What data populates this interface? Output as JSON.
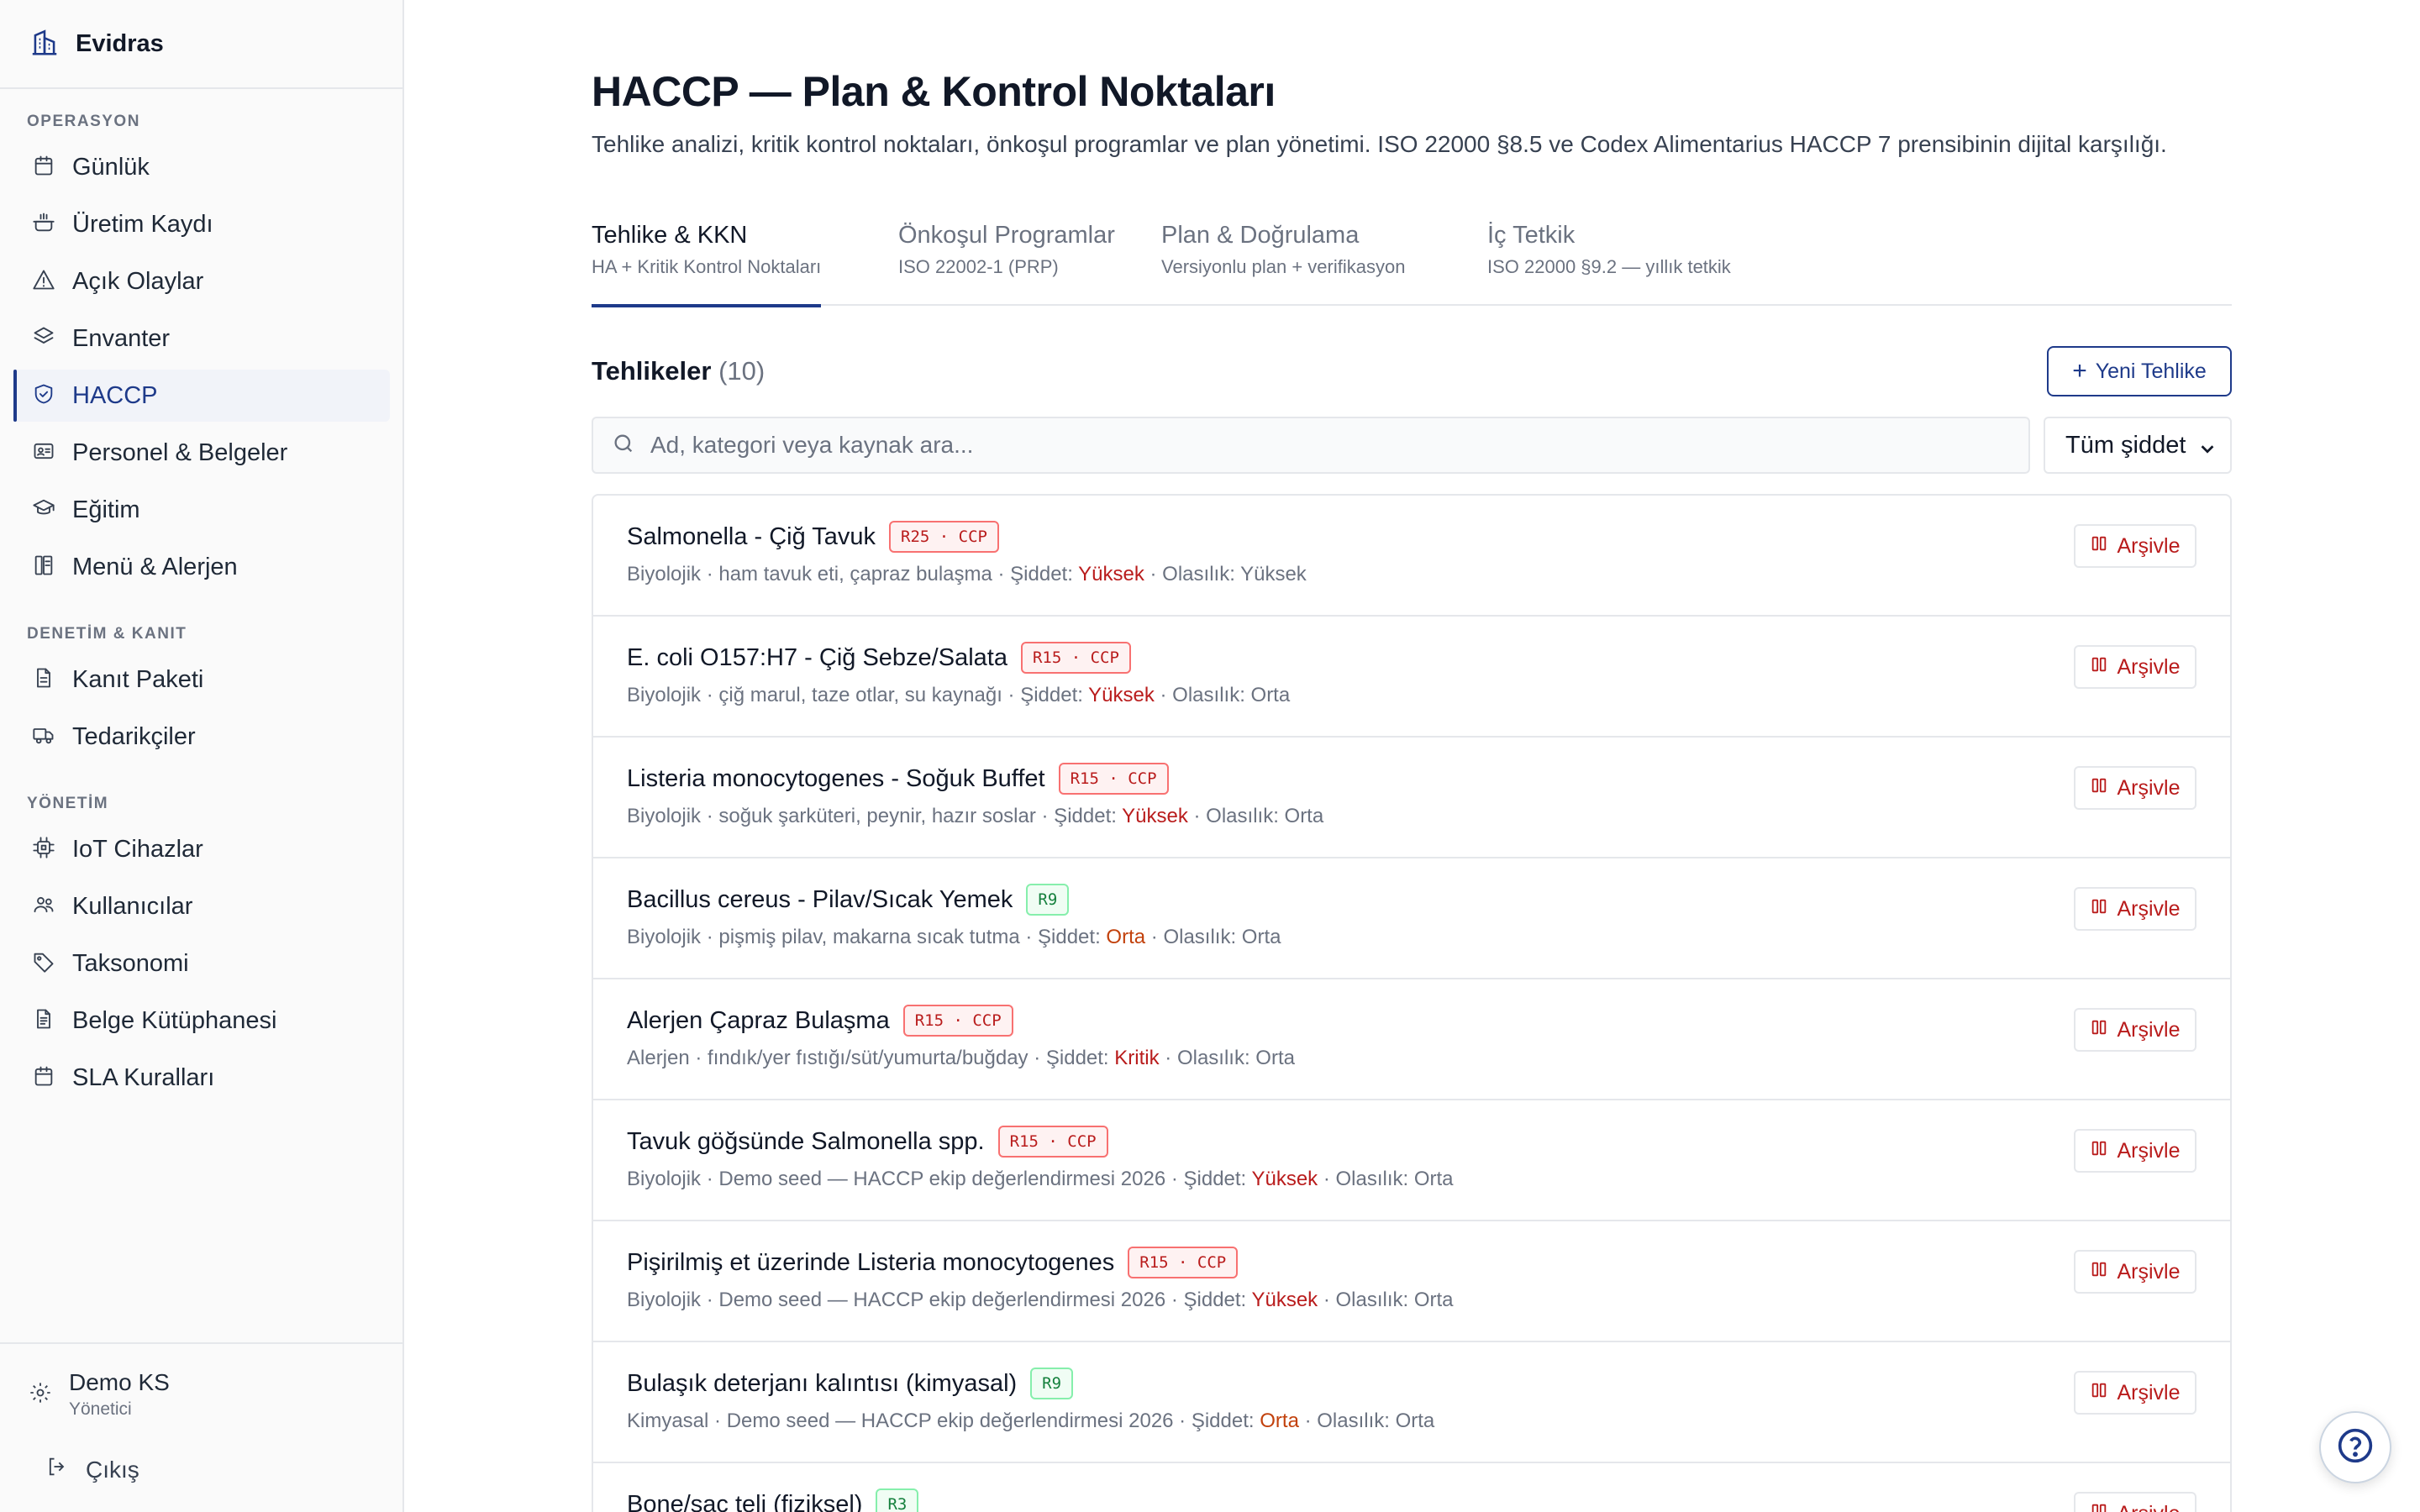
{
  "brand": {
    "name": "Evidras"
  },
  "sidebar": {
    "sections": [
      {
        "label": "OPERASYON",
        "items": [
          {
            "label": "Günlük",
            "icon": "calendar-icon"
          },
          {
            "label": "Üretim Kaydı",
            "icon": "cooking-pot-icon"
          },
          {
            "label": "Açık Olaylar",
            "icon": "warning-triangle-icon"
          },
          {
            "label": "Envanter",
            "icon": "layers-icon"
          },
          {
            "label": "HACCP",
            "icon": "shield-check-icon",
            "active": true
          },
          {
            "label": "Personel & Belgeler",
            "icon": "id-card-icon"
          },
          {
            "label": "Eğitim",
            "icon": "graduation-cap-icon"
          },
          {
            "label": "Menü & Alerjen",
            "icon": "menu-book-icon"
          }
        ]
      },
      {
        "label": "DENETİM & KANIT",
        "items": [
          {
            "label": "Kanıt Paketi",
            "icon": "document-icon"
          },
          {
            "label": "Tedarikçiler",
            "icon": "truck-icon"
          }
        ]
      },
      {
        "label": "YÖNETİM",
        "items": [
          {
            "label": "IoT Cihazlar",
            "icon": "chip-icon"
          },
          {
            "label": "Kullanıcılar",
            "icon": "users-icon"
          },
          {
            "label": "Taksonomi",
            "icon": "tag-icon"
          },
          {
            "label": "Belge Kütüphanesi",
            "icon": "file-text-icon"
          },
          {
            "label": "SLA Kuralları",
            "icon": "calendar-icon"
          }
        ]
      }
    ],
    "user": {
      "name": "Demo KS",
      "role": "Yönetici"
    },
    "logout_label": "Çıkış"
  },
  "page": {
    "title": "HACCP — Plan & Kontrol Noktaları",
    "description": "Tehlike analizi, kritik kontrol noktaları, önkoşul programlar ve plan yönetimi. ISO 22000 §8.5 ve Codex Alimentarius HACCP 7 prensibinin dijital karşılığı."
  },
  "tabs": [
    {
      "title": "Tehlike & KKN",
      "subtitle": "HA + Kritik Kontrol Noktaları",
      "active": true
    },
    {
      "title": "Önkoşul Programlar",
      "subtitle": "ISO 22002-1 (PRP)"
    },
    {
      "title": "Plan & Doğrulama",
      "subtitle": "Versiyonlu plan + verifikasyon"
    },
    {
      "title": "İç Tetkik",
      "subtitle": "ISO 22000 §9.2 — yıllık tetkik"
    }
  ],
  "hazards_header": {
    "title": "Tehlikeler",
    "count": "(10)",
    "new_button": "Yeni Tehlike"
  },
  "search": {
    "placeholder": "Ad, kategori veya kaynak ara...",
    "value": ""
  },
  "severity_filter": {
    "selected": "Tüm şiddet"
  },
  "labels": {
    "severity": "Şiddet:",
    "likelihood": "Olasılık:",
    "archive": "Arşivle",
    "sep": " · "
  },
  "colors": {
    "accent": "#1e3a8a",
    "danger": "#b91c1c",
    "warning": "#c2410c",
    "success": "#15803d"
  },
  "hazards": [
    {
      "name": "Salmonella - Çiğ Tavuk",
      "badge": "R25 · CCP",
      "badge_type": "red",
      "category": "Biyolojik",
      "source": "ham tavuk eti, çapraz bulaşma",
      "severity": "Yüksek",
      "severity_level": "hi",
      "likelihood": "Yüksek"
    },
    {
      "name": "E. coli O157:H7 - Çiğ Sebze/Salata",
      "badge": "R15 · CCP",
      "badge_type": "red",
      "category": "Biyolojik",
      "source": "çiğ marul, taze otlar, su kaynağı",
      "severity": "Yüksek",
      "severity_level": "hi",
      "likelihood": "Orta"
    },
    {
      "name": "Listeria monocytogenes - Soğuk Buffet",
      "badge": "R15 · CCP",
      "badge_type": "red",
      "category": "Biyolojik",
      "source": "soğuk şarküteri, peynir, hazır soslar",
      "severity": "Yüksek",
      "severity_level": "hi",
      "likelihood": "Orta"
    },
    {
      "name": "Bacillus cereus - Pilav/Sıcak Yemek",
      "badge": "R9",
      "badge_type": "green",
      "category": "Biyolojik",
      "source": "pişmiş pilav, makarna sıcak tutma",
      "severity": "Orta",
      "severity_level": "mid",
      "likelihood": "Orta"
    },
    {
      "name": "Alerjen Çapraz Bulaşma",
      "badge": "R15 · CCP",
      "badge_type": "red",
      "category": "Alerjen",
      "source": "fındık/yer fıstığı/süt/yumurta/buğday",
      "severity": "Kritik",
      "severity_level": "hi",
      "likelihood": "Orta"
    },
    {
      "name": "Tavuk göğsünde Salmonella spp.",
      "badge": "R15 · CCP",
      "badge_type": "red",
      "category": "Biyolojik",
      "source": "Demo seed — HACCP ekip değerlendirmesi 2026",
      "severity": "Yüksek",
      "severity_level": "hi",
      "likelihood": "Orta"
    },
    {
      "name": "Pişirilmiş et üzerinde Listeria monocytogenes",
      "badge": "R15 · CCP",
      "badge_type": "red",
      "category": "Biyolojik",
      "source": "Demo seed — HACCP ekip değerlendirmesi 2026",
      "severity": "Yüksek",
      "severity_level": "hi",
      "likelihood": "Orta"
    },
    {
      "name": "Bulaşık deterjanı kalıntısı (kimyasal)",
      "badge": "R9",
      "badge_type": "green",
      "category": "Kimyasal",
      "source": "Demo seed — HACCP ekip değerlendirmesi 2026",
      "severity": "Orta",
      "severity_level": "mid",
      "likelihood": "Orta"
    },
    {
      "name": "Bone/saç teli (fiziksel)",
      "badge": "R3",
      "badge_type": "green",
      "category": "",
      "source": "",
      "severity": "",
      "severity_level": "",
      "likelihood": ""
    }
  ]
}
